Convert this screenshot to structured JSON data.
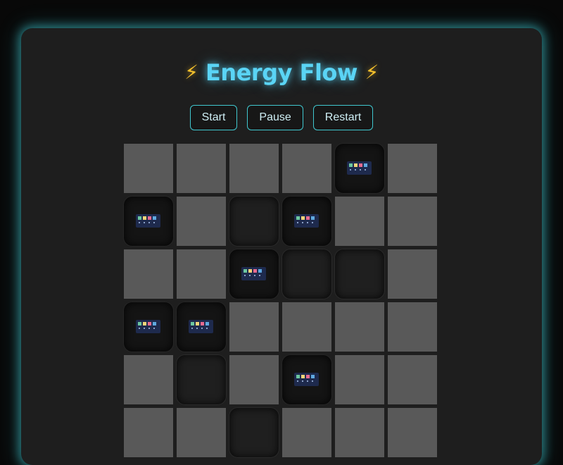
{
  "header": {
    "title": "Energy Flow",
    "bolt_symbol": "⚡"
  },
  "controls": {
    "start_label": "Start",
    "pause_label": "Pause",
    "restart_label": "Restart"
  },
  "board": {
    "columns": 6,
    "rows": [
      [
        "open",
        "open",
        "open",
        "open",
        "battery",
        "open"
      ],
      [
        "battery",
        "open",
        "dark",
        "battery",
        "open",
        "open"
      ],
      [
        "open",
        "open",
        "battery",
        "dark",
        "dark",
        "open"
      ],
      [
        "battery",
        "battery",
        "open",
        "open",
        "open",
        "open"
      ],
      [
        "open",
        "dark",
        "open",
        "battery",
        "open",
        "open"
      ],
      [
        "open",
        "open",
        "dark",
        "open",
        "open",
        "open"
      ]
    ]
  },
  "colors": {
    "accent": "#40c8d0",
    "title": "#5ad4f5",
    "bolt": "#f7c22c",
    "open_cell": "#595959",
    "battery_cell": "#141414"
  }
}
